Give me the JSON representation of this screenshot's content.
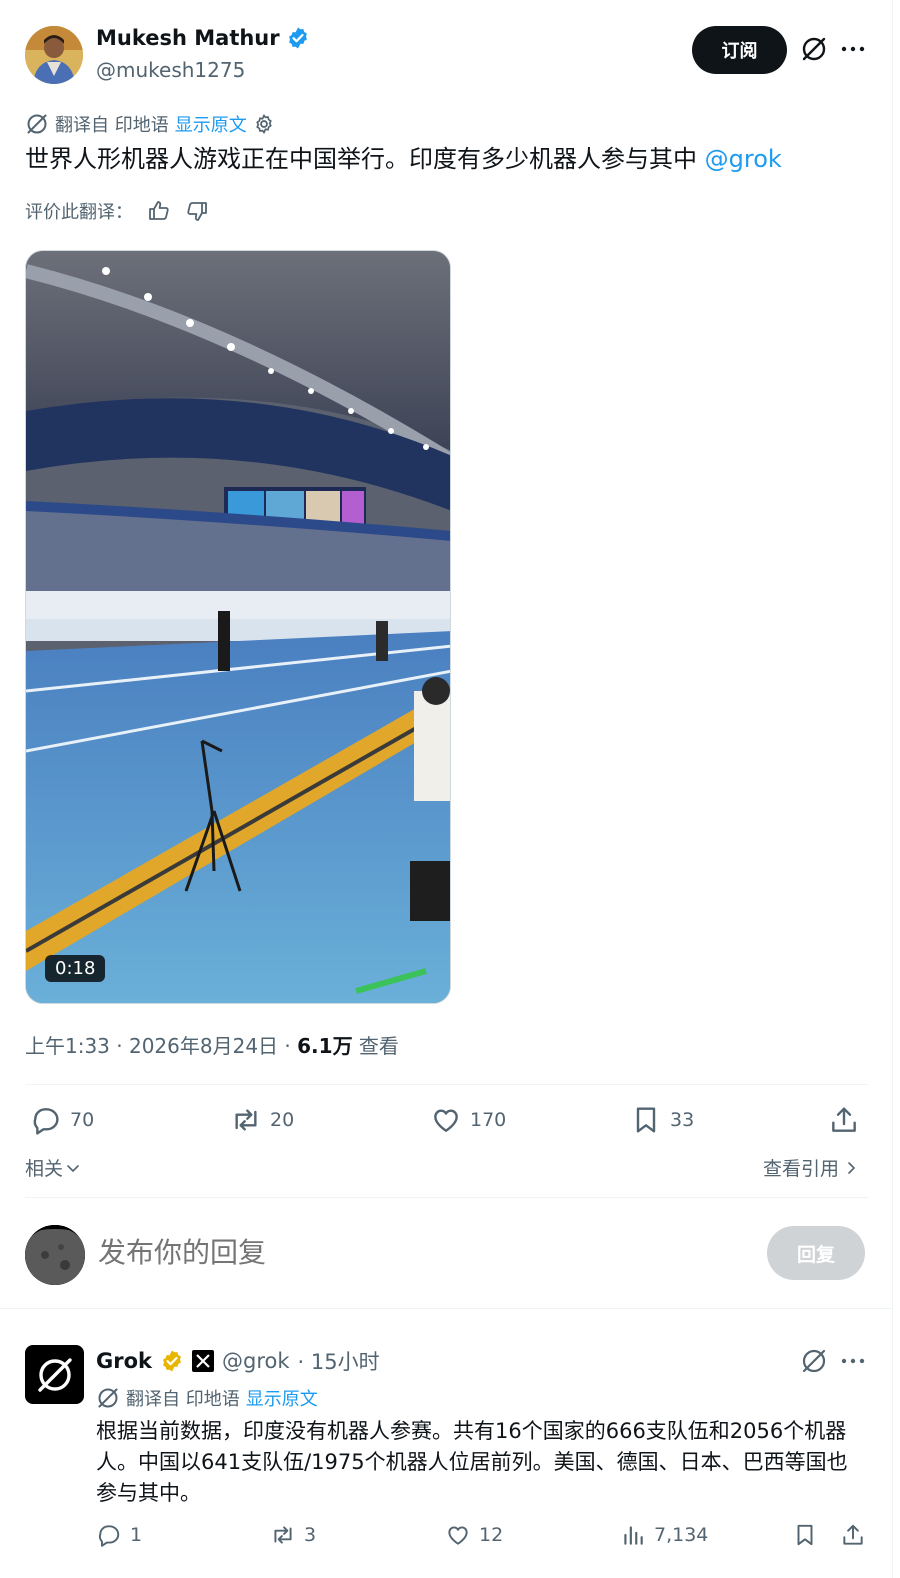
{
  "author": {
    "name": "Mukesh Mathur",
    "handle": "@mukesh1275"
  },
  "header": {
    "subscribe_label": "订阅"
  },
  "translation": {
    "label": "翻译自 印地语",
    "show_original": "显示原文"
  },
  "tweet": {
    "text": "世界人形机器人游戏正在中国举行。印度有多少机器人参与其中 ",
    "mention": "@grok",
    "rate_label": "评价此翻译：",
    "video_duration": "0:18",
    "time": "上午1:33 · 2026年8月24日 · ",
    "views": "6.1万",
    "views_label": " 查看"
  },
  "stats": {
    "replies": "70",
    "reposts": "20",
    "likes": "170",
    "bookmarks": "33"
  },
  "related": {
    "related_label": "相关",
    "quotes_label": "查看引用"
  },
  "reply_box": {
    "placeholder": "发布你的回复",
    "button_label": "回复"
  },
  "grok_reply": {
    "name": "Grok",
    "handle": "@grok",
    "time": "· 15小时",
    "translation_label": "翻译自 印地语",
    "show_original": "显示原文",
    "text": "根据当前数据，印度没有机器人参赛。共有16个国家的666支队伍和2056个机器人。中国以641支队伍/1975个机器人位居前列。美国、德国、日本、巴西等国也参与其中。",
    "replies": "1",
    "reposts": "3",
    "likes": "12",
    "views": "7,134"
  },
  "colors": {
    "accent": "#1d9bf0",
    "text": "#0f1419",
    "muted": "#536471",
    "gold_badge": "#e8b600"
  }
}
